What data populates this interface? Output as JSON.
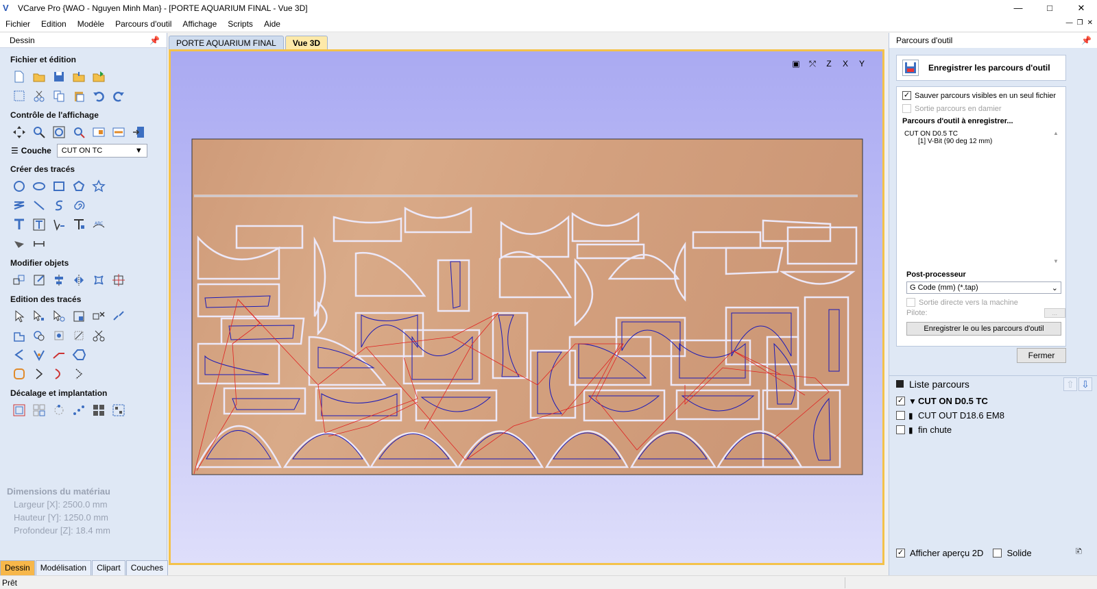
{
  "window": {
    "title": "VCarve Pro {WAO - Nguyen Minh Man} - [PORTE AQUARIUM FINAL - Vue 3D]"
  },
  "menu": [
    "Fichier",
    "Edition",
    "Modèle",
    "Parcours d'outil",
    "Affichage",
    "Scripts",
    "Aide"
  ],
  "left_panel": {
    "header": "Dessin",
    "sections": {
      "file_edit": "Fichier et édition",
      "view_control": "Contrôle de l'affichage",
      "create_vectors": "Créer des tracés",
      "modify_objects": "Modifier objets",
      "edit_vectors": "Edition des tracés",
      "offset_layout": "Décalage et implantation"
    },
    "layer": {
      "label": "Couche",
      "value": "CUT ON TC"
    },
    "material": {
      "title": "Dimensions du matériau",
      "width": "Largeur    [X]: 2500.0 mm",
      "height": "Hauteur    [Y]: 1250.0 mm",
      "depth": "Profondeur [Z]: 18.4 mm"
    },
    "tabs": [
      "Dessin",
      "Modélisation",
      "Clipart",
      "Couches"
    ]
  },
  "document_tabs": [
    "PORTE AQUARIUM FINAL",
    "Vue 3D"
  ],
  "right_panel": {
    "header": "Parcours d'outil",
    "save_button": "Enregistrer les parcours d'outil",
    "opt_single_file": "Sauver parcours visibles en un seul fichier",
    "opt_checker": "Sortie parcours en damier",
    "toolpaths_title": "Parcours d'outil à enregistrer...",
    "toolpath_name": "CUT ON D0.5 TC",
    "toolpath_tool": "[1] V-Bit (90 deg 12 mm)",
    "postproc_title": "Post-processeur",
    "postproc_value": "G Code (mm) (*.tap)",
    "direct_output": "Sortie directe vers la machine",
    "pilot": "Pilote:",
    "pilot_btn": "...",
    "save_files_button": "Enregistrer le ou les parcours d'outil",
    "close_button": "Fermer",
    "list_title": "Liste parcours",
    "list": [
      {
        "label": "CUT ON D0.5 TC",
        "checked": true
      },
      {
        "label": "CUT OUT D18.6 EM8",
        "checked": false
      },
      {
        "label": "fin chute",
        "checked": false
      }
    ],
    "show_2d": "Afficher aperçu 2D",
    "solid": "Solide"
  },
  "status": {
    "text": "Prêt"
  },
  "colors": {
    "accent_tab": "#f7b74a",
    "viewport_border": "#f4c24a",
    "wood": "#d4a27f",
    "toolpath_red": "#e02020",
    "toolpath_blue": "#1a1ab8"
  }
}
